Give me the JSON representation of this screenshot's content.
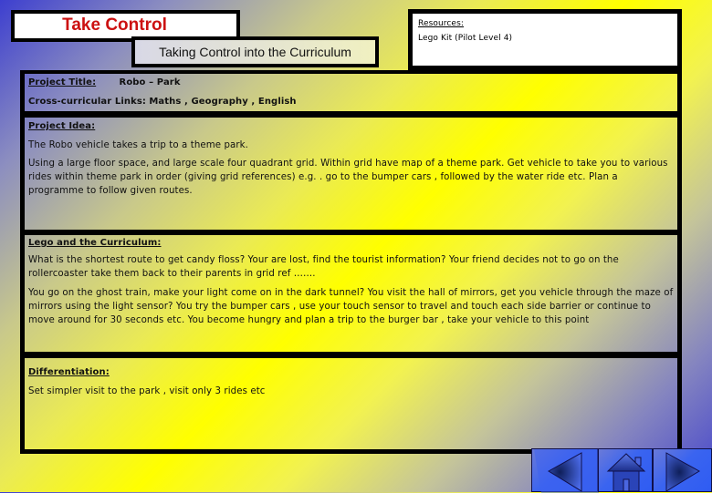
{
  "header": {
    "title": "Take Control",
    "subtitle": "Taking Control into the Curriculum"
  },
  "resources": {
    "heading": "Resources:",
    "items": [
      "Lego Kit (Pilot Level 4)"
    ]
  },
  "project": {
    "title_label": "Project Title:",
    "title_value": "Robo – Park",
    "links_label": "Cross-curricular Links:",
    "links_value": "Maths , Geography , English"
  },
  "idea": {
    "heading": "Project Idea:",
    "paragraphs": [
      "The Robo vehicle takes a trip to a theme park.",
      "Using a large floor space, and large scale  four quadrant grid. Within grid have map of a theme park. Get vehicle to take you to various rides within theme park in order (giving grid references) e.g. . go to the bumper cars , followed by the water ride etc. Plan a programme to follow given routes."
    ]
  },
  "curriculum": {
    "heading": "Lego and the Curriculum:",
    "paragraphs": [
      "What is the shortest route to get candy floss? Your are lost, find the tourist information? Your friend decides not to go on the rollercoaster take them back to their parents in grid ref …….",
      "You go on the ghost train, make your light come on in the dark tunnel? You visit the hall of mirrors, get you vehicle through the maze of mirrors using the light sensor? You try the bumper cars , use your touch sensor to travel and touch each side barrier or continue to move around for 30 seconds etc. You become hungry and plan a trip to the burger bar , take your vehicle to this point"
    ]
  },
  "differentiation": {
    "heading": "Differentiation:",
    "paragraphs": [
      "Set simpler visit to the park , visit only 3 rides etc"
    ]
  },
  "navigation": {
    "back_icon": "triangle-left-icon",
    "home_icon": "house-icon",
    "forward_icon": "triangle-right-icon"
  },
  "colors": {
    "title_red": "#cc1111",
    "nav_blue": "#2f5cf2",
    "frame_black": "#000000",
    "accent_yellow": "#ffff00",
    "accent_blue": "#3d3fcf"
  }
}
